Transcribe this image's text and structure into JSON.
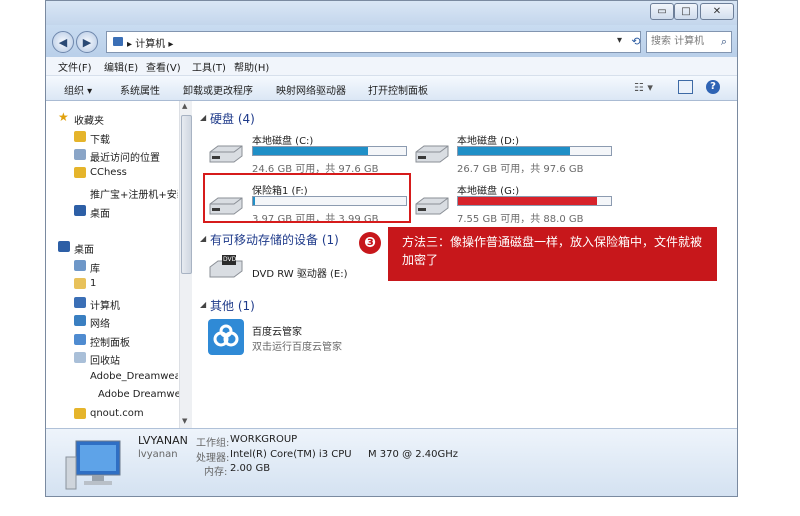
{
  "window": {
    "controls": {
      "minimize": "▭",
      "maximize": "□",
      "close": "✕"
    }
  },
  "address": {
    "back": "◀",
    "forward": "▶",
    "path": "▸ 计算机 ▸",
    "dropdown": "▾",
    "refresh": "⟲",
    "search_placeholder": "搜索 计算机"
  },
  "menu": {
    "file": "文件(F)",
    "edit": "编辑(E)",
    "view": "查看(V)",
    "tools": "工具(T)",
    "help": "帮助(H)"
  },
  "toolbar": {
    "organize": "组织 ▾",
    "system_properties": "系统属性",
    "uninstall": "卸载或更改程序",
    "map_drive": "映射网络驱动器",
    "control_panel": "打开控制面板"
  },
  "sidebar": {
    "items": [
      {
        "label": "收藏夹"
      },
      {
        "label": "下载"
      },
      {
        "label": "最近访问的位置"
      },
      {
        "label": "CChess"
      },
      {
        "label": "推广宝+注册机+安装"
      },
      {
        "label": "桌面"
      },
      {
        "label": "桌面"
      },
      {
        "label": "库"
      },
      {
        "label": "1"
      },
      {
        "label": "计算机"
      },
      {
        "label": "网络"
      },
      {
        "label": "控制面板"
      },
      {
        "label": "回收站"
      },
      {
        "label": "Adobe_Dreamweaver"
      },
      {
        "label": "Adobe Dreamwe"
      },
      {
        "label": "qnout.com"
      }
    ]
  },
  "groups": {
    "hard_disks": "硬盘 (4)",
    "removable": "有可移动存储的设备 (1)",
    "other": "其他 (1)"
  },
  "drives": [
    {
      "name": "本地磁盘 (C:)",
      "info": "24.6 GB 可用，共 97.6 GB",
      "used_fraction": 0.75,
      "color": "#1f8fc7"
    },
    {
      "name": "本地磁盘 (D:)",
      "info": "26.7 GB 可用，共 97.6 GB",
      "used_fraction": 0.73,
      "color": "#1f8fc7"
    },
    {
      "name": "保险箱1 (F:)",
      "info": "3.97 GB 可用，共 3.99 GB",
      "used_fraction": 0.005,
      "color": "#1f8fc7"
    },
    {
      "name": "本地磁盘 (G:)",
      "info": "7.55 GB 可用，共 88.0 GB",
      "used_fraction": 0.91,
      "color": "#d7222a"
    }
  ],
  "dvd": {
    "name": "DVD RW 驱动器 (E:)",
    "icon_label": "DVD"
  },
  "other_item": {
    "name": "百度云管家",
    "desc": "双击运行百度云管家"
  },
  "callout": {
    "number": "❸",
    "text": "方法三：像操作普通磁盘一样，放入保险箱中，文件就被加密了"
  },
  "details": {
    "computer_name": "LVYANAN",
    "user": "lvyanan",
    "workgroup_label": "工作组:",
    "workgroup": "WORKGROUP",
    "cpu_label": "处理器:",
    "cpu": "Intel(R) Core(TM) i3 CPU",
    "cpu_model": "M 370  @ 2.40GHz",
    "ram_label": "内存:",
    "ram": "2.00 GB"
  },
  "colors": {
    "accent": "#c7171b",
    "bar_blue": "#1f8fc7",
    "bar_red": "#d7222a"
  }
}
